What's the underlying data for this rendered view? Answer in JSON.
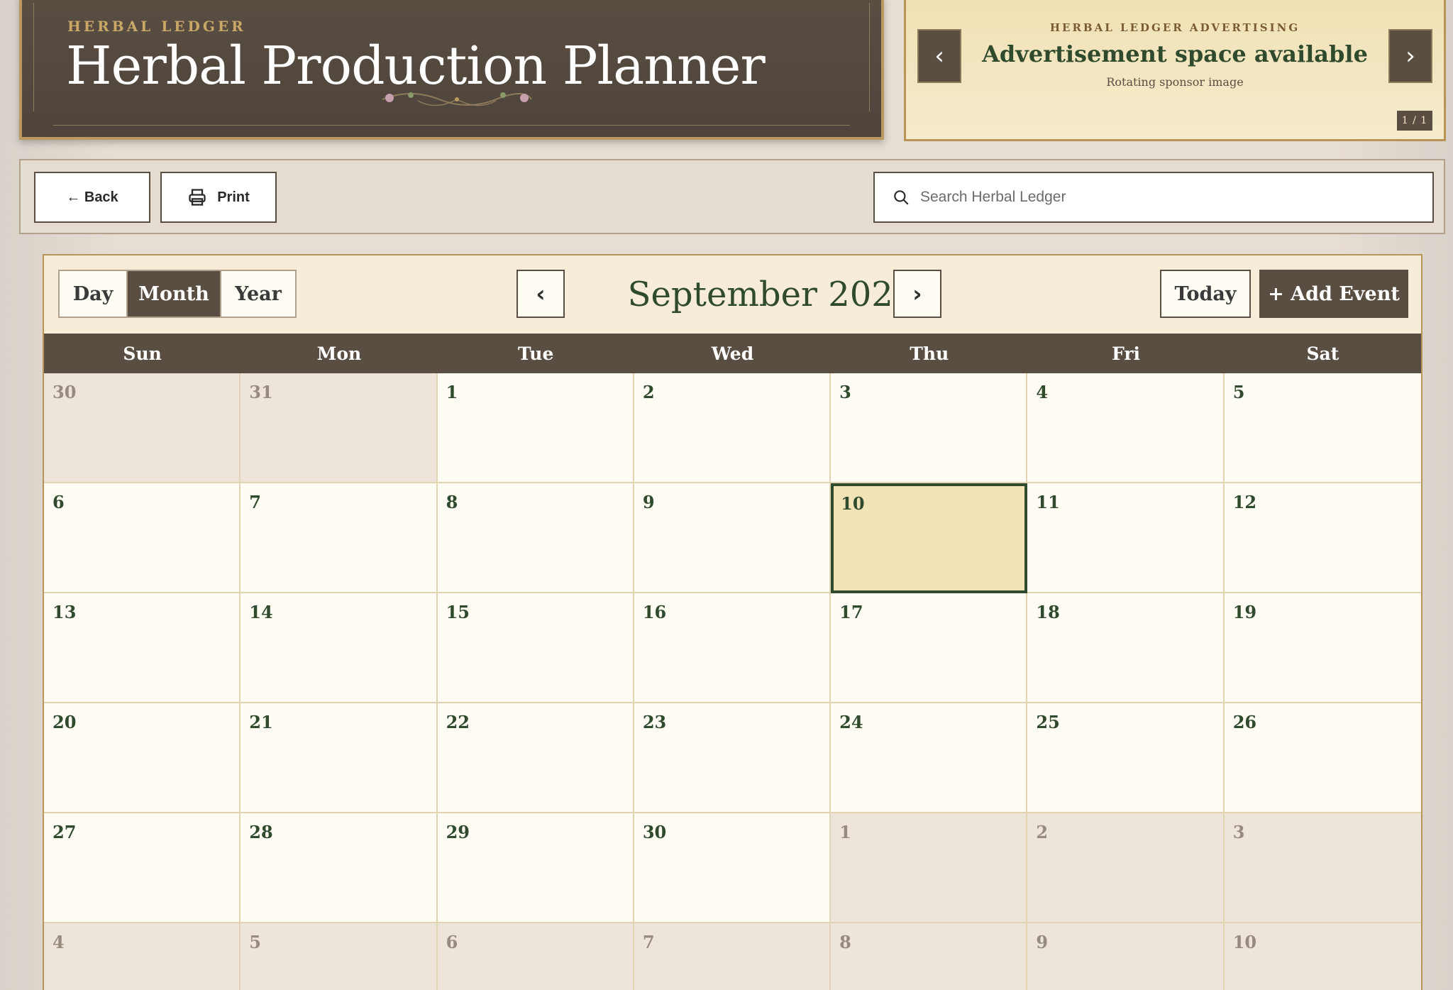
{
  "banner": {
    "kicker": "HERBAL LEDGER",
    "title": "Herbal Production Planner"
  },
  "ad": {
    "kicker": "HERBAL LEDGER ADVERTISING",
    "title": "Advertisement space available",
    "subtitle": "Rotating sponsor image",
    "counter": "1 / 1",
    "prev_icon": "chevron-left-icon",
    "next_icon": "chevron-right-icon"
  },
  "toolbar": {
    "back_label": "← Back",
    "print_label": "Print",
    "print_icon": "printer-icon",
    "search_icon": "search-icon",
    "search_placeholder": "Search Herbal Ledger"
  },
  "calendar": {
    "views": [
      "Day",
      "Month",
      "Year"
    ],
    "active_view": "Month",
    "month_title": "September 2026",
    "today_label": "Today",
    "add_event_label": "+ Add Event",
    "weekdays": [
      "Sun",
      "Mon",
      "Tue",
      "Wed",
      "Thu",
      "Fri",
      "Sat"
    ],
    "days": [
      {
        "n": "30",
        "other": true
      },
      {
        "n": "31",
        "other": true
      },
      {
        "n": "1"
      },
      {
        "n": "2"
      },
      {
        "n": "3"
      },
      {
        "n": "4"
      },
      {
        "n": "5"
      },
      {
        "n": "6"
      },
      {
        "n": "7"
      },
      {
        "n": "8"
      },
      {
        "n": "9"
      },
      {
        "n": "10",
        "today": true
      },
      {
        "n": "11"
      },
      {
        "n": "12"
      },
      {
        "n": "13"
      },
      {
        "n": "14"
      },
      {
        "n": "15"
      },
      {
        "n": "16"
      },
      {
        "n": "17"
      },
      {
        "n": "18"
      },
      {
        "n": "19"
      },
      {
        "n": "20"
      },
      {
        "n": "21"
      },
      {
        "n": "22"
      },
      {
        "n": "23"
      },
      {
        "n": "24"
      },
      {
        "n": "25"
      },
      {
        "n": "26"
      },
      {
        "n": "27"
      },
      {
        "n": "28"
      },
      {
        "n": "29"
      },
      {
        "n": "30"
      },
      {
        "n": "1",
        "other": true
      },
      {
        "n": "2",
        "other": true
      },
      {
        "n": "3",
        "other": true
      },
      {
        "n": "4",
        "other": true
      },
      {
        "n": "5",
        "other": true
      },
      {
        "n": "6",
        "other": true
      },
      {
        "n": "7",
        "other": true
      },
      {
        "n": "8",
        "other": true
      },
      {
        "n": "9",
        "other": true
      },
      {
        "n": "10",
        "other": true
      }
    ]
  },
  "colors": {
    "brown": "#5a4e43",
    "gold": "#b69556",
    "green": "#2f4a2d",
    "cream": "#fffcf3",
    "today_fill": "#f2e3b6"
  }
}
